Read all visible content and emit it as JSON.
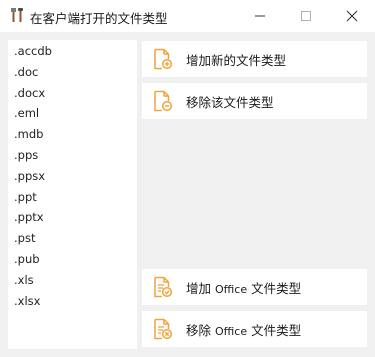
{
  "window": {
    "title": "在客户端打开的文件类型",
    "icons": {
      "app": "tools-icon",
      "minimize": "minimize-icon",
      "maximize": "maximize-icon",
      "close": "close-icon"
    }
  },
  "file_types": [
    ".accdb",
    ".doc",
    ".docx",
    ".eml",
    ".mdb",
    ".pps",
    ".ppsx",
    ".ppt",
    ".pptx",
    ".pst",
    ".pub",
    ".xls",
    ".xlsx"
  ],
  "actions": {
    "add_type": {
      "label": "增加新的文件类型",
      "icon": "file-add-icon"
    },
    "remove_type": {
      "label": "移除该文件类型",
      "icon": "file-remove-icon"
    },
    "add_office": {
      "label_pre": "增加 ",
      "label_latin": "Office",
      "label_post": " 文件类型",
      "icon": "file-list-check-icon"
    },
    "remove_office": {
      "label_pre": "移除 ",
      "label_latin": "Office",
      "label_post": " 文件类型",
      "icon": "file-list-remove-icon"
    }
  },
  "colors": {
    "accent": "#f0a43a",
    "window_bg": "#f0f0f0",
    "panel_bg": "#ffffff"
  }
}
